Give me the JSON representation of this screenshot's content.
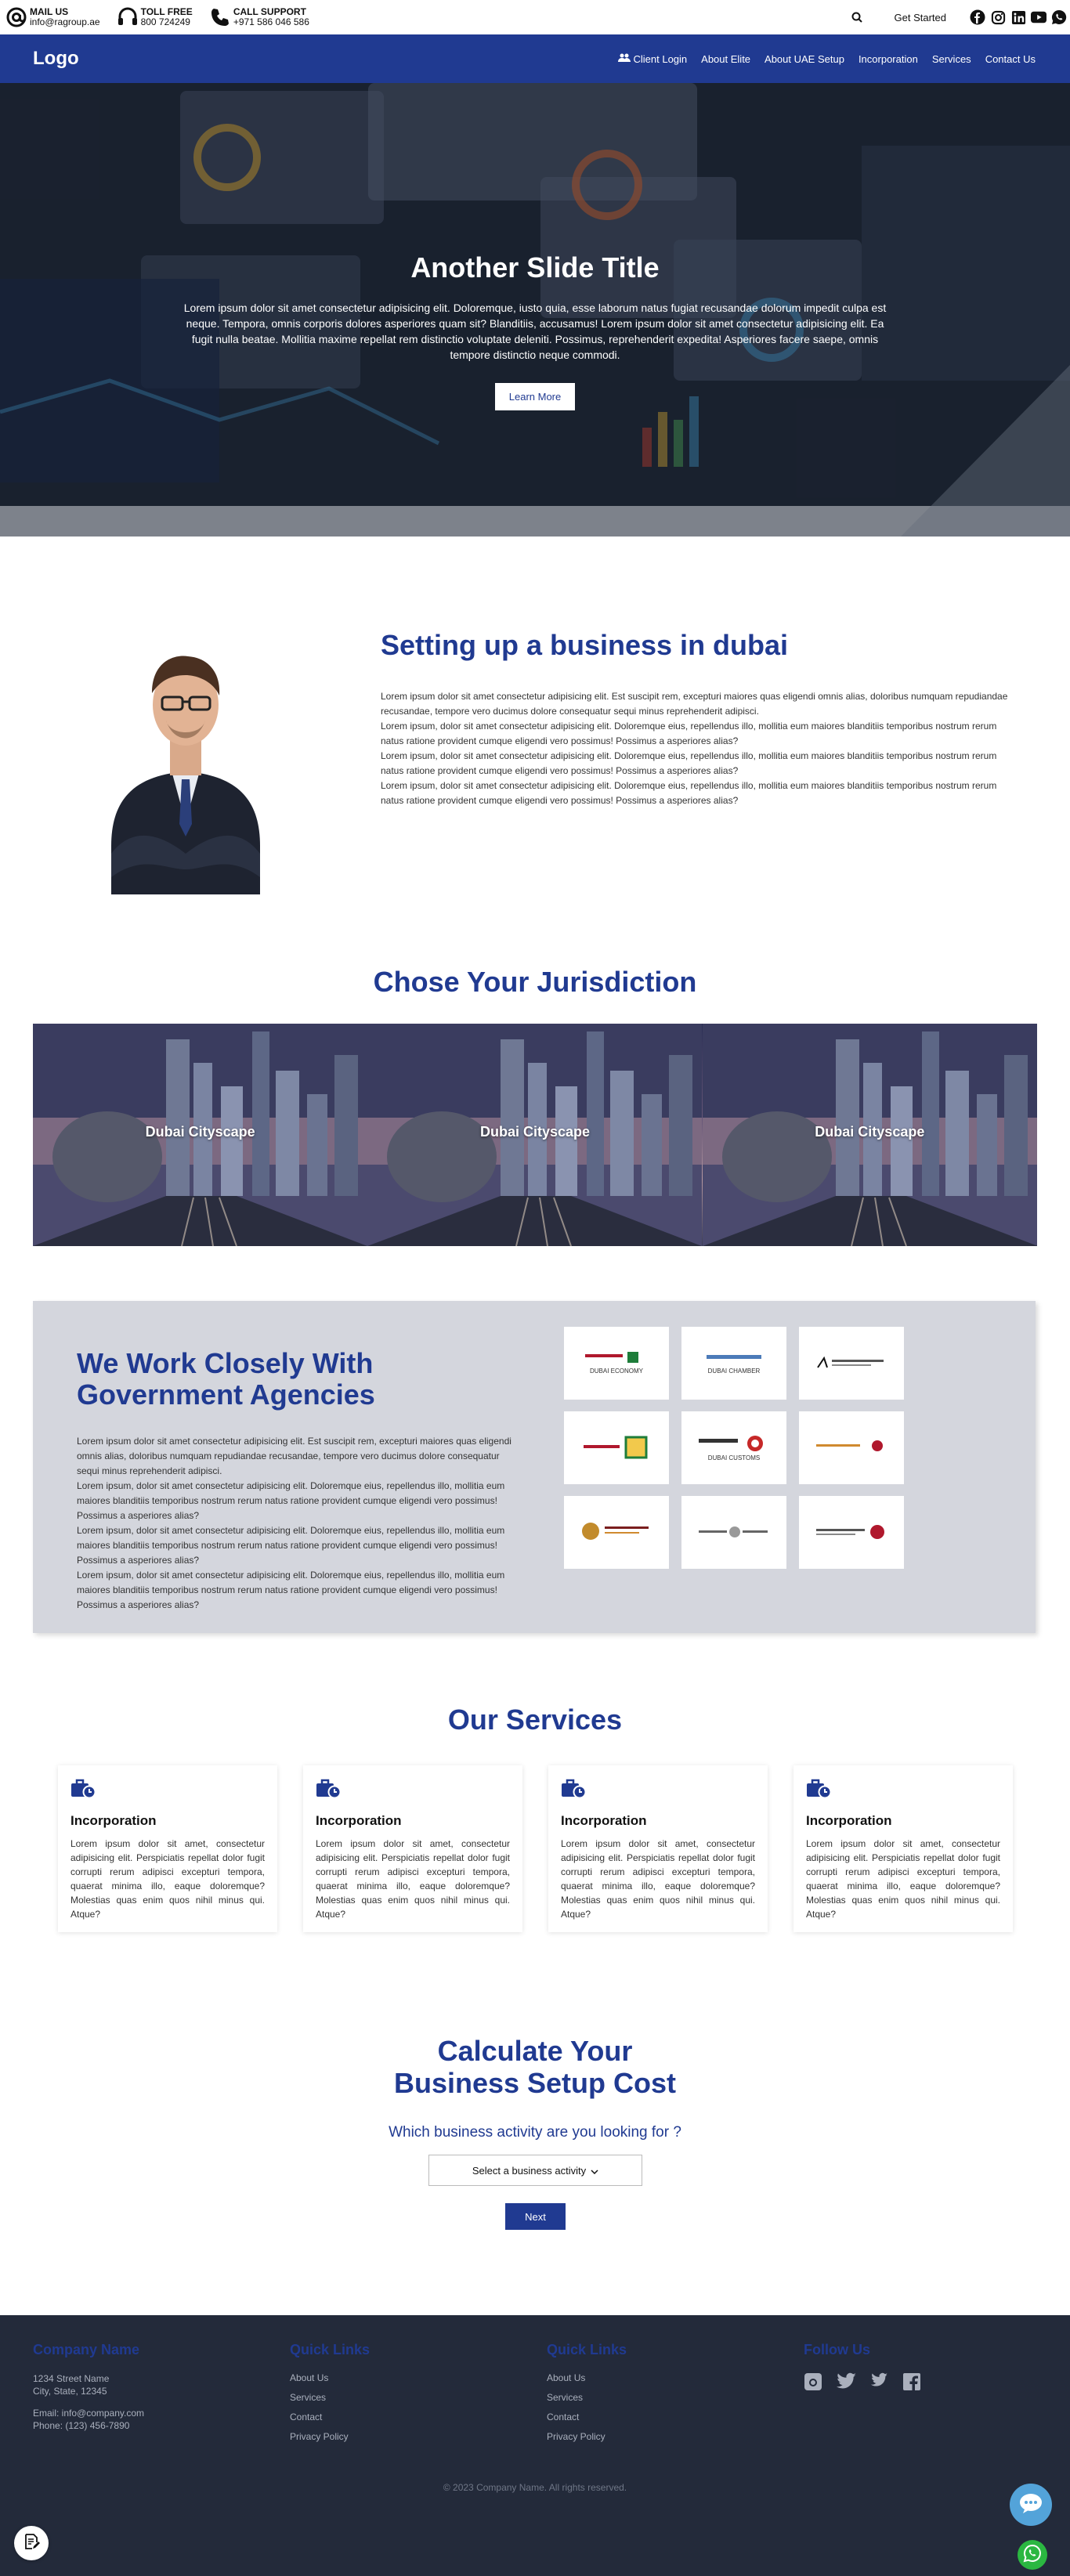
{
  "topbar": {
    "mail": {
      "label": "MAIL US",
      "value": "info@ragroup.ae",
      "icon": "at-icon"
    },
    "tollfree": {
      "label": "TOLL FREE",
      "value": "800 724249",
      "icon": "headset-icon"
    },
    "support": {
      "label": "CALL SUPPORT",
      "value": "+971 586 046 586",
      "icon": "phone-icon"
    },
    "get_started": "Get Started",
    "socials": [
      "facebook-icon",
      "instagram-icon",
      "linkedin-icon",
      "youtube-icon",
      "whatsapp-icon"
    ]
  },
  "nav": {
    "logo": "Logo",
    "links": [
      "Client Login",
      "About Elite",
      "About UAE Setup",
      "Incorporation",
      "Services",
      "Contact Us"
    ]
  },
  "hero": {
    "title": "Another Slide Title",
    "text": "Lorem ipsum dolor sit amet consectetur adipisicing elit. Doloremque, iusto quia, esse laborum natus fugiat recusandae dolorum impedit culpa est neque. Tempora, omnis corporis dolores asperiores quam sit? Blanditiis, accusamus! Lorem ipsum dolor sit amet consectetur adipisicing elit. Ea fugit nulla beatae. Mollitia maxime repellat rem distinctio voluptate deleniti. Possimus, reprehenderit expedita! Asperiores facere saepe, omnis tempore distinctio neque commodi.",
    "button": "Learn More"
  },
  "setup": {
    "title": "Setting up a business in dubai",
    "paragraphs": [
      "Lorem ipsum dolor sit amet consectetur adipisicing elit. Est suscipit rem, excepturi maiores quas eligendi omnis alias, doloribus numquam repudiandae recusandae, tempore vero ducimus dolore consequatur sequi minus reprehenderit adipisci.",
      "Lorem ipsum, dolor sit amet consectetur adipisicing elit. Doloremque eius, repellendus illo, mollitia eum maiores blanditiis temporibus nostrum rerum natus ratione provident cumque eligendi vero possimus! Possimus a asperiores alias?",
      "Lorem ipsum, dolor sit amet consectetur adipisicing elit. Doloremque eius, repellendus illo, mollitia eum maiores blanditiis temporibus nostrum rerum natus ratione provident cumque eligendi vero possimus! Possimus a asperiores alias?",
      "Lorem ipsum, dolor sit amet consectetur adipisicing elit. Doloremque eius, repellendus illo, mollitia eum maiores blanditiis temporibus nostrum rerum natus ratione provident cumque eligendi vero possimus! Possimus a asperiores alias?"
    ]
  },
  "jurisdiction": {
    "title": "Chose Your Jurisdiction",
    "cards": [
      "Dubai Cityscape",
      "Dubai Cityscape",
      "Dubai Cityscape"
    ]
  },
  "government": {
    "title": "We Work Closely With Government Agencies",
    "paragraphs": [
      "Lorem ipsum dolor sit amet consectetur adipisicing elit. Est suscipit rem, excepturi maiores quas eligendi omnis alias, doloribus numquam repudiandae recusandae, tempore vero ducimus dolore consequatur sequi minus reprehenderit adipisci.",
      "Lorem ipsum, dolor sit amet consectetur adipisicing elit. Doloremque eius, repellendus illo, mollitia eum maiores blanditiis temporibus nostrum rerum natus ratione provident cumque eligendi vero possimus! Possimus a asperiores alias?",
      "Lorem ipsum, dolor sit amet consectetur adipisicing elit. Doloremque eius, repellendus illo, mollitia eum maiores blanditiis temporibus nostrum rerum natus ratione provident cumque eligendi vero possimus! Possimus a asperiores alias?",
      "Lorem ipsum, dolor sit amet consectetur adipisicing elit. Doloremque eius, repellendus illo, mollitia eum maiores blanditiis temporibus nostrum rerum natus ratione provident cumque eligendi vero possimus! Possimus a asperiores alias?"
    ],
    "logos": [
      {
        "name": "DUBAI ECONOMY"
      },
      {
        "name": "DUBAI CHAMBER"
      },
      {
        "name": ""
      },
      {
        "name": ""
      },
      {
        "name": "DUBAI CUSTOMS"
      },
      {
        "name": ""
      },
      {
        "name": ""
      },
      {
        "name": ""
      },
      {
        "name": ""
      }
    ]
  },
  "services": {
    "title": "Our Services",
    "cards": [
      {
        "name": "Incorporation",
        "desc": "Lorem ipsum dolor sit amet, consectetur adipisicing elit. Perspiciatis repellat dolor fugit corrupti rerum adipisci excepturi tempora, quaerat minima illo, eaque doloremque? Molestias quas enim quos nihil minus qui. Atque?"
      },
      {
        "name": "Incorporation",
        "desc": "Lorem ipsum dolor sit amet, consectetur adipisicing elit. Perspiciatis repellat dolor fugit corrupti rerum adipisci excepturi tempora, quaerat minima illo, eaque doloremque? Molestias quas enim quos nihil minus qui. Atque?"
      },
      {
        "name": "Incorporation",
        "desc": "Lorem ipsum dolor sit amet, consectetur adipisicing elit. Perspiciatis repellat dolor fugit corrupti rerum adipisci excepturi tempora, quaerat minima illo, eaque doloremque? Molestias quas enim quos nihil minus qui. Atque?"
      },
      {
        "name": "Incorporation",
        "desc": "Lorem ipsum dolor sit amet, consectetur adipisicing elit. Perspiciatis repellat dolor fugit corrupti rerum adipisci excepturi tempora, quaerat minima illo, eaque doloremque? Molestias quas enim quos nihil minus qui. Atque?"
      }
    ]
  },
  "calculator": {
    "title_line1": "Calculate Your",
    "title_line2": "Business Setup Cost",
    "question": "Which business activity are you looking for ?",
    "select_value": "Select a business activity",
    "next": "Next"
  },
  "footer": {
    "company": {
      "heading": "Company Name",
      "address1": "1234 Street Name",
      "address2": "City, State, 12345",
      "email": "Email: info@company.com",
      "phone": "Phone: (123) 456-7890"
    },
    "quick1": {
      "heading": "Quick Links",
      "links": [
        "About Us",
        "Services",
        "Contact",
        "Privacy Policy"
      ]
    },
    "quick2": {
      "heading": "Quick Links",
      "links": [
        "About Us",
        "Services",
        "Contact",
        "Privacy Policy"
      ]
    },
    "follow": {
      "heading": "Follow Us",
      "icons": [
        "instagram-icon",
        "twitter-icon",
        "twitter-icon",
        "facebook-icon"
      ]
    },
    "copyright": "© 2023 Company Name. All rights reserved."
  },
  "colors": {
    "brand": "#203a91",
    "footer_bg": "#232a3a",
    "gov_bg": "#d4d6dd"
  }
}
